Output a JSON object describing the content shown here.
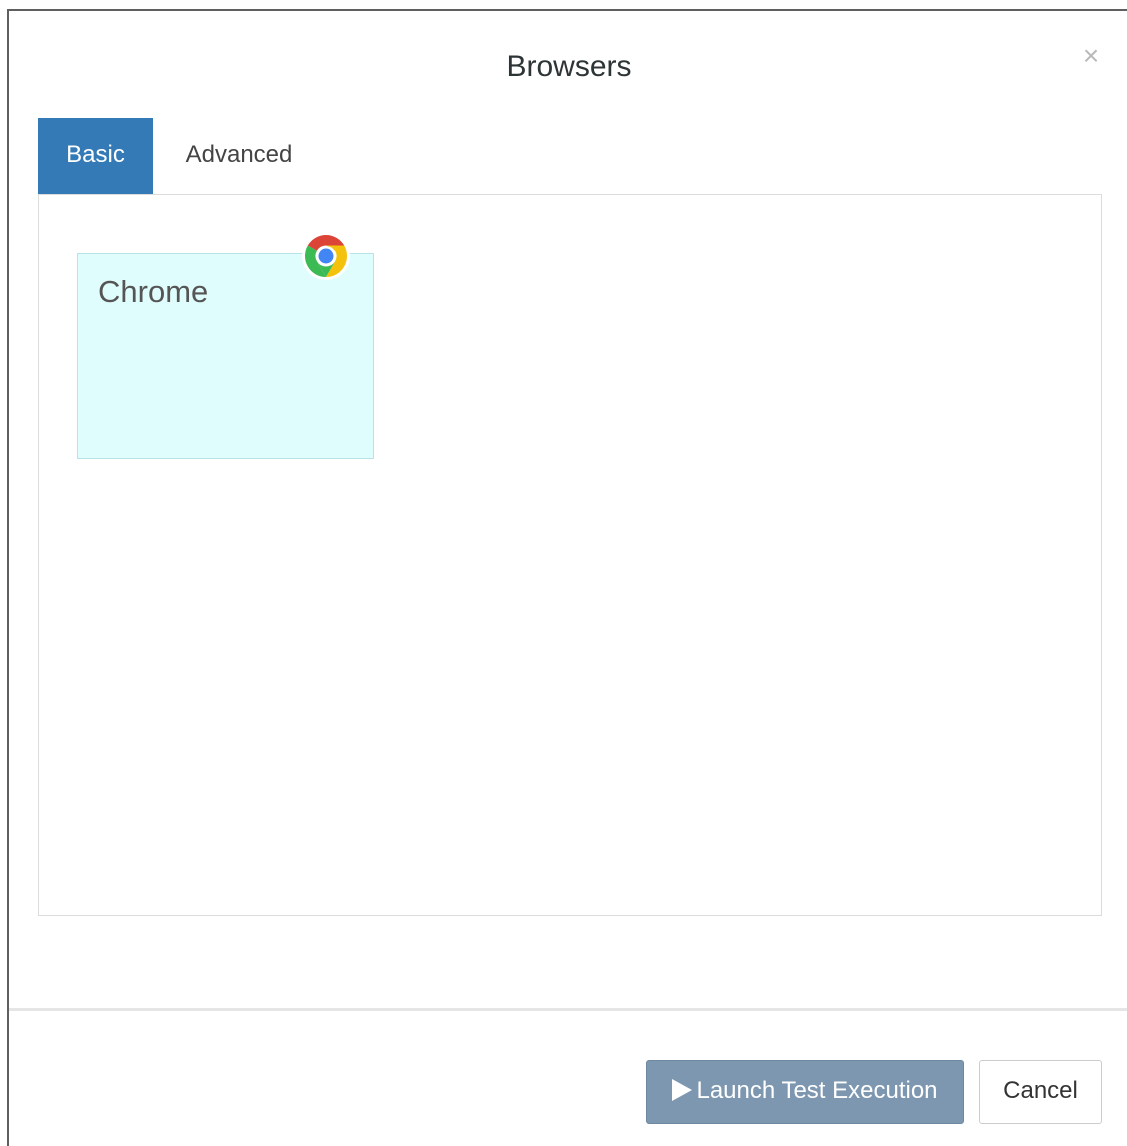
{
  "modal": {
    "title": "Browsers",
    "close_symbol": "×"
  },
  "tabs": [
    {
      "label": "Basic",
      "active": true
    },
    {
      "label": "Advanced",
      "active": false
    }
  ],
  "browsers": [
    {
      "name": "Chrome",
      "icon": "chrome-icon"
    }
  ],
  "footer": {
    "launch_label": "Launch Test Execution",
    "cancel_label": "Cancel"
  },
  "colors": {
    "accent": "#337ab7",
    "card_background": "#e0fdfd",
    "launch_button": "#7d97b0"
  }
}
